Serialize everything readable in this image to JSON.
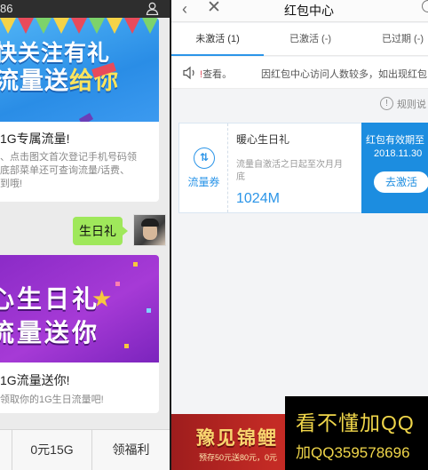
{
  "left_pane": {
    "status_number": "86",
    "card1": {
      "banner_line1": "快关注有礼",
      "banner_line2a": "流量送",
      "banner_line2b": "给你",
      "title": "1G专属流量!",
      "desc_lines": [
        "、点击图文首次登记手机号码领",
        "底部菜单还可查询流量/话费、",
        "到哦!"
      ]
    },
    "chat_message": "生日礼",
    "card2": {
      "banner_line1": "心生日礼",
      "banner_line2": "流量送你",
      "title": "1G流量送你!",
      "desc": "领取你的1G生日流量吧!"
    },
    "bottom_menu": [
      "",
      "0元15G",
      "领福利"
    ]
  },
  "right_pane": {
    "nav_title": "红包中心",
    "tabs": [
      "未激活 (1)",
      "已激活 (-)",
      "已过期 (-)"
    ],
    "notice_check": "查看",
    "notice_text": "因红包中心访问人数较多，如出现红包",
    "rules_label": "规则说",
    "coupon": {
      "type_label": "流量券",
      "name": "暖心生日礼",
      "desc_lines": [
        "流量自激活之日起至次月月",
        "底"
      ],
      "amount": "1024M",
      "expiry_label": "红包有效期至",
      "expiry_date": "2018.11.30",
      "activate_button": "去激活"
    },
    "ad": {
      "headline": "豫见锦鲤",
      "subline": "预存50元送80元，0元"
    }
  },
  "watermark": {
    "line1": "看不懂加QQ",
    "line2": "加QQ359578696"
  },
  "colors": {
    "accent_blue": "#2b95e8",
    "coupon_side": "#1c8de0",
    "chat_bubble": "#9fe85b",
    "watermark_text": "#f0d64a"
  }
}
